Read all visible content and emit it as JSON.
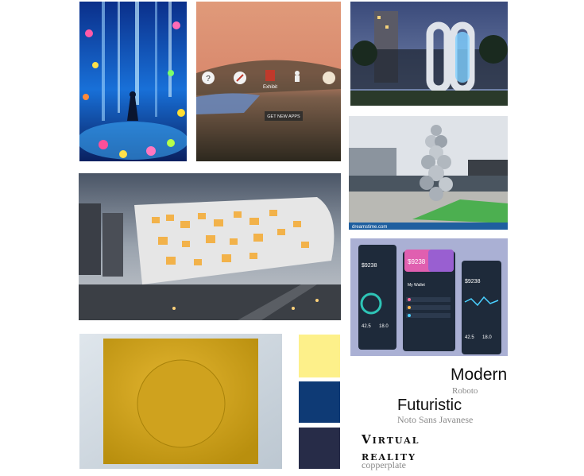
{
  "images": [
    {
      "name": "digital-art-waterfall-image",
      "caption": ""
    },
    {
      "name": "vr-home-screen-image",
      "caption": ""
    },
    {
      "name": "oval-sculpture-night-image",
      "caption": ""
    },
    {
      "name": "steel-sphere-sculpture-image",
      "caption": "dreamstime.com"
    },
    {
      "name": "modern-library-building-image",
      "caption": ""
    },
    {
      "name": "wallet-app-mockup-image",
      "caption": ""
    },
    {
      "name": "yellow-circle-painting-image",
      "caption": ""
    }
  ],
  "vr_menu": {
    "icons": [
      "help-icon",
      "explore-icon",
      "exhibit-icon",
      "person-icon",
      "dial-icon"
    ],
    "exhibit_label": "Exhibit",
    "get_apps": "GET NEW APPS"
  },
  "wallet": {
    "amount": "$9238",
    "title": "My Wallet",
    "small1": "42.5",
    "small2": "18.0"
  },
  "palette": [
    "#fdf08a",
    "#0e3a75",
    "#272c48"
  ],
  "typography": [
    {
      "label": "Modern",
      "font": "Roboto"
    },
    {
      "label": "Futuristic",
      "font": "Noto Sans Javanese"
    },
    {
      "label": "Virtual reality",
      "font": "copperplate"
    }
  ]
}
